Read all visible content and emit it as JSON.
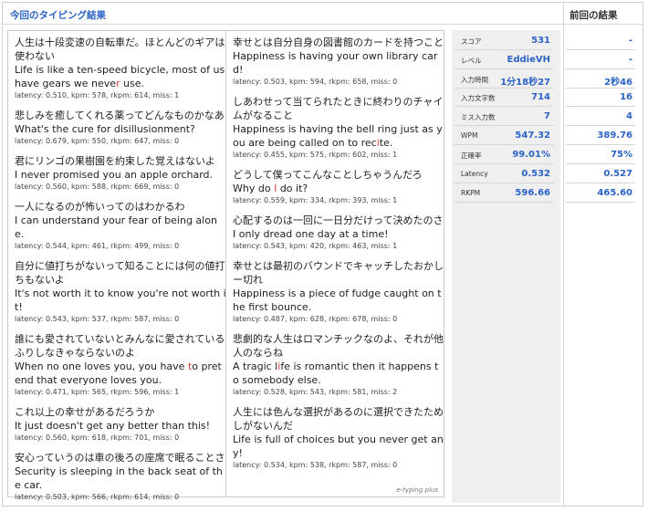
{
  "header": {
    "title": "今回のタイピング結果",
    "previous_title": "前回の結果"
  },
  "colors": {
    "accent": "#2a63c6",
    "miss": "#e0423b"
  },
  "left_column": [
    {
      "jp": "人生は十段変速の自転車だ。ほとんどのギアは使わない",
      "en_parts": [
        "Life is like a ten-speed bicycle, most of us have gears we neve",
        "r",
        " use."
      ],
      "stats": "latency: 0.510, kpm: 578, rkpm: 614, miss: 1"
    },
    {
      "jp": "悲しみを癒してくれる薬ってどんなものかなあ",
      "en_parts": [
        "What's the cure for disillusionment?",
        "",
        ""
      ],
      "stats": "latency: 0.679, kpm: 550, rkpm: 647, miss: 0"
    },
    {
      "jp": "君にリンゴの果樹園を約束した覚えはないよ",
      "en_parts": [
        "I never promised you an apple orchard.",
        "",
        ""
      ],
      "stats": "latency: 0.560, kpm: 588, rkpm: 669, miss: 0"
    },
    {
      "jp": "一人になるのが怖いってのはわかるわ",
      "en_parts": [
        "I can understand your fear of being alone.",
        "",
        ""
      ],
      "stats": "latency: 0.544, kpm: 461, rkpm: 499, miss: 0"
    },
    {
      "jp": "自分に値打ちがないって知ることには何の値打ちもないよ",
      "en_parts": [
        "It's not worth it to know you're not worth it!",
        "",
        ""
      ],
      "stats": "latency: 0.543, kpm: 537, rkpm: 587, miss: 0"
    },
    {
      "jp": "誰にも愛されていないとみんなに愛されているふりしなきゃならないのよ",
      "en_parts": [
        "When no one loves you, you have ",
        "t",
        "o pretend that everyone loves you."
      ],
      "stats": "latency: 0.471, kpm: 565, rkpm: 596, miss: 1"
    },
    {
      "jp": "これ以上の幸せがあるだろうか",
      "en_parts": [
        "It just doesn't get any better than this!",
        "",
        ""
      ],
      "stats": "latency: 0.560, kpm: 618, rkpm: 701, miss: 0"
    },
    {
      "jp": "安心っていうのは車の後ろの座席で眠ることさ",
      "en_parts": [
        "Security is sleeping in the back seat of the car.",
        "",
        ""
      ],
      "stats": "latency: 0.503, kpm: 566, rkpm: 614, miss: 0"
    }
  ],
  "right_column": [
    {
      "jp": "幸せとは自分自身の図書館のカードを持つこと",
      "en_parts": [
        "Happiness is having your own library card!",
        "",
        ""
      ],
      "stats": "latency: 0.503, kpm: 594, rkpm: 658, miss: 0"
    },
    {
      "jp": "しあわせって当てられたときに終わりのチャイムがなること",
      "en_parts": [
        "Happiness is having the bell ring just as you are being called on to rec",
        "i",
        "te."
      ],
      "stats": "latency: 0.455, kpm: 575, rkpm: 602, miss: 1"
    },
    {
      "jp": "どうして僕ってこんなことしちゃうんだろ",
      "en_parts": [
        "Why do ",
        "I",
        " do it?"
      ],
      "stats": "latency: 0.559, kpm: 334, rkpm: 393, miss: 1"
    },
    {
      "jp": "心配するのは一回に一日分だけって決めたのさ",
      "en_parts": [
        "I only dread one day at a time!",
        "",
        ""
      ],
      "stats": "latency: 0.543, kpm: 420, rkpm: 463, miss: 1"
    },
    {
      "jp": "幸せとは最初のバウンドでキャッチしたおかしー切れ",
      "en_parts": [
        "Happiness is a piece of fudge caught on the first bounce.",
        "",
        ""
      ],
      "stats": "latency: 0.487, kpm: 628, rkpm: 678, miss: 0"
    },
    {
      "jp": "悲劇的な人生はロマンチックなのよ、それが他人のならね",
      "en_parts": [
        "A tragic l",
        "i",
        "fe is romantic then it happens to somebody else."
      ],
      "stats": "latency: 0.528, kpm: 543, rkpm: 581, miss: 2"
    },
    {
      "jp": "人生には色んな選択があるのに選択できたためしがないんだ",
      "en_parts": [
        "Life is full of choices but you never get any!",
        "",
        ""
      ],
      "stats": "latency: 0.534, kpm: 538, rkpm: 587, miss: 0"
    }
  ],
  "credit": "e-typing plus",
  "summary": [
    {
      "label": "スコア",
      "current": "531",
      "previous": "-"
    },
    {
      "label": "レベル",
      "current": "EddieVH",
      "previous": "-"
    },
    {
      "label": "入力時間",
      "current": "1分18秒27",
      "previous": "2秒46"
    },
    {
      "label": "入力文字数",
      "current": "714",
      "previous": "16"
    },
    {
      "label": "ミス入力数",
      "current": "7",
      "previous": "4"
    },
    {
      "label": "WPM",
      "current": "547.32",
      "previous": "389.76"
    },
    {
      "label": "正確率",
      "current": "99.01%",
      "previous": "75%"
    },
    {
      "label": "Latency",
      "current": "0.532",
      "previous": "0.527"
    },
    {
      "label": "RKPM",
      "current": "596.66",
      "previous": "465.60"
    }
  ]
}
